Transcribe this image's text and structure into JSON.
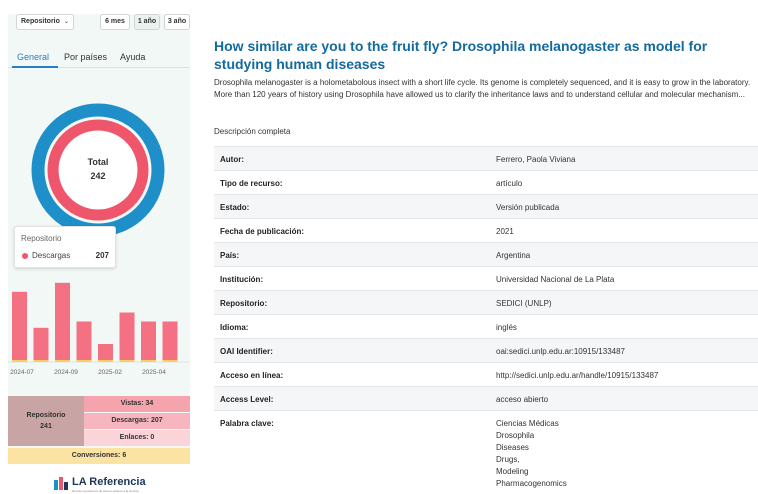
{
  "stats": {
    "repo_select": "Repositorio",
    "periods": [
      "6 mes",
      "1 año",
      "3 año"
    ],
    "tabs": [
      "General",
      "Por países",
      "Ayuda"
    ],
    "donut": {
      "label": "Total",
      "value": "242"
    },
    "tooltip": {
      "title": "Repositorio",
      "label": "Descargas",
      "value": "207"
    },
    "bar_chart": {
      "tick_labels": [
        "2024-07",
        "2024-09",
        "2025-02",
        "2025-04"
      ],
      "values": [
        78,
        38,
        88,
        45,
        20,
        55,
        45,
        45
      ],
      "colors": {
        "bar": "#f47083",
        "accent": "#f9d25e"
      }
    },
    "summary": {
      "repo_label": "Repositorio",
      "repo_value": "241",
      "vistas": "Vistas: 34",
      "descargas": "Descargas: 207",
      "enlaces": "Enlaces: 0",
      "conversiones": "Conversiones: 6"
    },
    "logo": {
      "name": "LA Referencia",
      "tagline": "Red de repositorios de acceso abierto a la ciencia"
    }
  },
  "colors": {
    "title": "#136a9e",
    "donut_outer": "#1f8fc9",
    "donut_inner": "#f0566b",
    "tab_active": "#2a7dc9"
  },
  "record": {
    "title": "How similar are you to the fruit fly? Drosophila melanogaster as model for studying human diseases",
    "description": "Drosophila melanogaster is a holometabolous insect with a short life cycle. Its genome is completely sequenced, and it is easy to grow in the laboratory. More than 120 years of history using Drosophila have allowed us to clarify the inheritance laws and to understand cellular and molecular mechanism...",
    "full_description_link": "Descripción completa",
    "fields": [
      {
        "key": "Autor:",
        "value": "Ferrero, Paola Viviana"
      },
      {
        "key": "Tipo de recurso:",
        "value": "artículo"
      },
      {
        "key": "Estado:",
        "value": "Versión publicada"
      },
      {
        "key": "Fecha de publicación:",
        "value": "2021"
      },
      {
        "key": "País:",
        "value": "Argentina"
      },
      {
        "key": "Institución:",
        "value": "Universidad Nacional de La Plata"
      },
      {
        "key": "Repositorio:",
        "value": "SEDICI (UNLP)"
      },
      {
        "key": "Idioma:",
        "value": "inglés"
      },
      {
        "key": "OAI Identifier:",
        "value": "oai:sedici.unlp.edu.ar:10915/133487"
      },
      {
        "key": "Acceso en línea:",
        "value": "http://sedici.unlp.edu.ar/handle/10915/133487"
      },
      {
        "key": "Access Level:",
        "value": "acceso abierto"
      }
    ],
    "keywords_label": "Palabra clave:",
    "keywords": [
      "Ciencias Médicas",
      "Drosophila",
      "Diseases",
      "Drugs,",
      "Modeling",
      "Pharmacogenomics"
    ]
  }
}
